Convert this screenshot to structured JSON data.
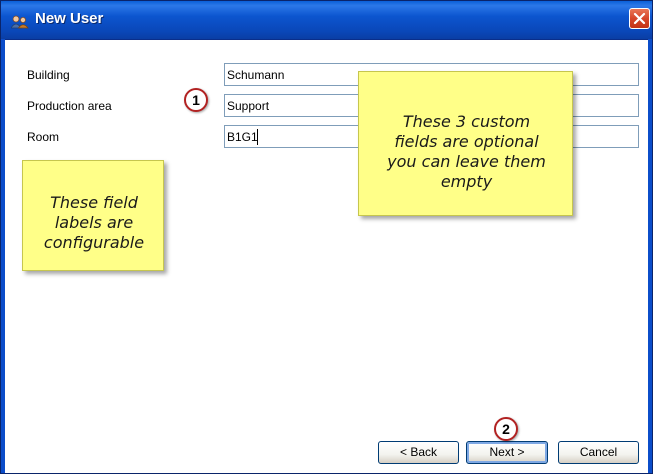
{
  "window": {
    "title": "New User",
    "app_icon": "users-icon",
    "close_icon": "close-icon"
  },
  "form": {
    "fields": [
      {
        "label": "Building",
        "value": "Schumann"
      },
      {
        "label": "Production area",
        "value": "Support"
      },
      {
        "label": "Room",
        "value": "B1G1"
      }
    ]
  },
  "annotations": {
    "marker_1": "1",
    "marker_2": "2",
    "note_custom_fields": [
      "These 3 custom",
      "fields are optional",
      "you can leave them",
      "empty"
    ],
    "note_labels": [
      "These field",
      "labels are",
      "configurable"
    ]
  },
  "buttons": {
    "back": "< Back",
    "next": "Next >",
    "cancel": "Cancel"
  },
  "colors": {
    "titlebar": "#0a54d0",
    "close_button": "#d6462a",
    "note_fill": "#ffff88",
    "marker_border": "#b22222"
  }
}
